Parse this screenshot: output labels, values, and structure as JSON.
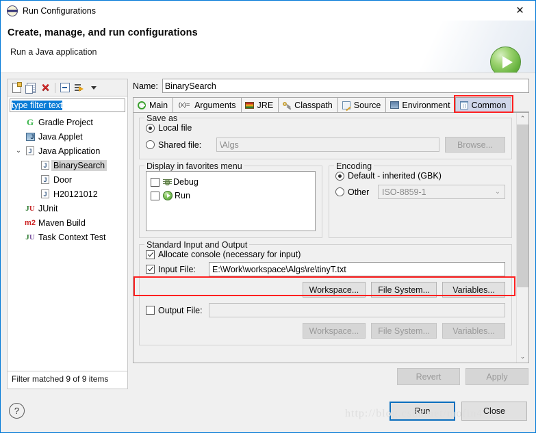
{
  "window": {
    "title": "Run Configurations",
    "app_icon": "eclipse-icon",
    "close_label": "✕"
  },
  "header": {
    "title": "Create, manage, and run configurations",
    "subtitle": "Run a Java application",
    "badge_icon": "run-play-icon"
  },
  "tree_toolbar": {
    "items": [
      {
        "name": "new-configuration-icon",
        "glyph": "new-doc"
      },
      {
        "name": "duplicate-configuration-icon",
        "glyph": "duplicate"
      },
      {
        "name": "delete-configuration-icon",
        "glyph": "delete-x"
      },
      {
        "name": "collapse-all-icon",
        "glyph": "collapse"
      },
      {
        "name": "filter-configurations-icon",
        "glyph": "filter"
      },
      {
        "name": "view-menu-chevron-icon",
        "glyph": "caret-down"
      }
    ]
  },
  "filter": {
    "value": "type filter text",
    "placeholder": "type filter text",
    "status": "Filter matched 9 of 9 items"
  },
  "tree": {
    "items": [
      {
        "label": "Gradle Project",
        "icon": "gradle-icon",
        "indent": 0,
        "twisty": "",
        "selected": false
      },
      {
        "label": "Java Applet",
        "icon": "java-applet-icon",
        "indent": 0,
        "twisty": "",
        "selected": false
      },
      {
        "label": "Java Application",
        "icon": "java-application-icon",
        "indent": 0,
        "twisty": "expanded",
        "selected": false
      },
      {
        "label": "BinarySearch",
        "icon": "java-application-icon",
        "indent": 1,
        "twisty": "",
        "selected": true
      },
      {
        "label": "Door",
        "icon": "java-application-icon",
        "indent": 1,
        "twisty": "",
        "selected": false
      },
      {
        "label": "H20121012",
        "icon": "java-application-icon",
        "indent": 1,
        "twisty": "",
        "selected": false
      },
      {
        "label": "JUnit",
        "icon": "junit-icon",
        "indent": 0,
        "twisty": "",
        "selected": false
      },
      {
        "label": "Maven Build",
        "icon": "maven-icon",
        "indent": 0,
        "twisty": "",
        "selected": false
      },
      {
        "label": "Task Context Test",
        "icon": "task-context-icon",
        "indent": 0,
        "twisty": "",
        "selected": false
      }
    ]
  },
  "name_field": {
    "label": "Name:",
    "value": "BinarySearch",
    "placeholder": ""
  },
  "tabs": [
    {
      "label": "Main",
      "icon": "main-tab-icon",
      "active": false
    },
    {
      "label": "Arguments",
      "icon": "arguments-tab-icon",
      "active": false
    },
    {
      "label": "JRE",
      "icon": "jre-tab-icon",
      "active": false
    },
    {
      "label": "Classpath",
      "icon": "classpath-tab-icon",
      "active": false
    },
    {
      "label": "Source",
      "icon": "source-tab-icon",
      "active": false
    },
    {
      "label": "Environment",
      "icon": "environment-tab-icon",
      "active": false
    },
    {
      "label": "Common",
      "icon": "common-tab-icon",
      "active": true
    }
  ],
  "save_as": {
    "legend": "Save as",
    "local_file": {
      "label": "Local file",
      "selected": true
    },
    "shared_file": {
      "label": "Shared file:",
      "selected": false,
      "value": "\\Algs"
    },
    "browse_button": "Browse..."
  },
  "favorites": {
    "legend": "Display in favorites menu",
    "items": [
      {
        "label": "Debug",
        "icon": "debug-icon",
        "checked": false
      },
      {
        "label": "Run",
        "icon": "run-icon",
        "checked": false
      }
    ]
  },
  "encoding": {
    "legend": "Encoding",
    "default_option": {
      "label": "Default - inherited (GBK)",
      "selected": true
    },
    "other_option": {
      "label": "Other",
      "selected": false,
      "value": "ISO-8859-1"
    }
  },
  "standard_io": {
    "legend": "Standard Input and Output",
    "allocate_console": {
      "label": "Allocate console (necessary for input)",
      "checked": true
    },
    "input_file": {
      "label": "Input File:",
      "checked": true,
      "value": "E:\\Work\\workspace\\Algs\\re\\tinyT.txt"
    },
    "buttons": [
      "Workspace...",
      "File System...",
      "Variables..."
    ],
    "output_file": {
      "label": "Output File:",
      "checked": false,
      "value": ""
    }
  },
  "apply_bar": {
    "revert": "Revert",
    "apply": "Apply"
  },
  "footer": {
    "help_icon": "help-icon",
    "help_glyph": "?",
    "run_button": "Run",
    "close_button": "Close"
  },
  "watermark": "http://blog.csdn.net/mofin4",
  "colors": {
    "accent": "#0078d7",
    "annotation_red": "#ff2020",
    "selection_blue": "#0a7cd6",
    "active_tab": "#cfd6ea"
  }
}
